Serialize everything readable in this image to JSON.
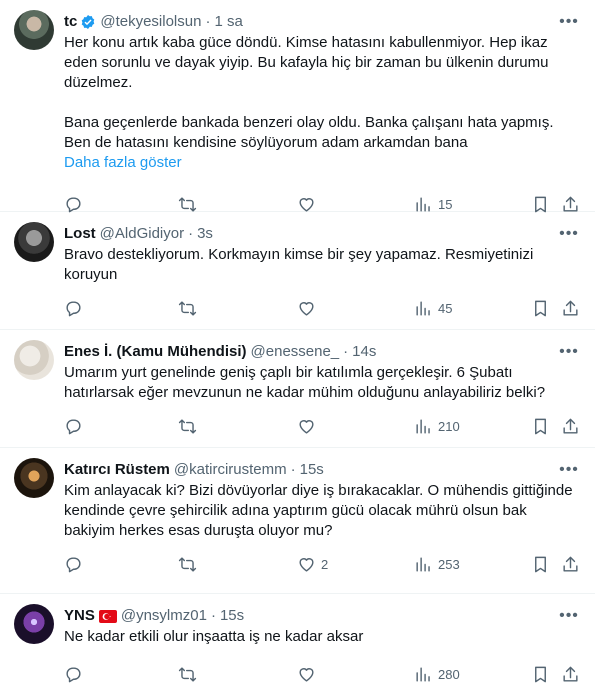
{
  "tweets": [
    {
      "name": "tc",
      "handle": "@tekyesilolsun",
      "dot": "·",
      "time": "1 sa",
      "text": "Her konu artık kaba güce döndü. Kimse hatasını kabullenmiyor. Hep ikaz eden sorunlu ve dayak yiyip. Bu kafayla hiç bir zaman bu ülkenin durumu düzelmez.\n\nBana geçenlerde bankada benzeri olay oldu. Banka çalışanı hata yapmış. Ben de hatasını kendisine söylüyorum adam arkamdan bana",
      "show_more": "Daha fazla göster",
      "views": "15",
      "verified": true
    },
    {
      "name": "Lost",
      "handle": "@AldGidiyor",
      "dot": "·",
      "time": "3s",
      "text": "Bravo destekliyorum. Korkmayın kimse bir şey yapamaz. Resmiyetinizi koruyun",
      "views": "45"
    },
    {
      "name": "Enes İ. (Kamu Mühendisi)",
      "handle": "@enessene_",
      "dot": "·",
      "time": "14s",
      "text": "Umarım yurt genelinde geniş çaplı bir katılımla gerçekleşir. 6 Şubatı hatırlarsak eğer mevzunun ne kadar mühim olduğunu anlayabiliriz belki?",
      "views": "210"
    },
    {
      "name": "Katırcı Rüstem",
      "handle": "@katircirustemm",
      "dot": "·",
      "time": "15s",
      "text": "Kim anlayacak ki? Bizi dövüyorlar diye iş bırakacaklar. O mühendis gittiğinde kendinde çevre şehircilik adına yaptırım gücü olacak mührü olsun bak bakiyim herkes esas duruşta oluyor mu?",
      "likes": "2",
      "views": "253"
    },
    {
      "name": "YNS",
      "handle": "@ynsylmz01",
      "dot": "·",
      "time": "15s",
      "text": "Ne kadar etkili olur inşaatta iş ne kadar aksar",
      "views": "280",
      "flag": "turkey-flag"
    }
  ],
  "icons": {
    "reply": "reply-icon",
    "retweet": "retweet-icon",
    "like": "heart-icon",
    "views": "views-icon",
    "bookmark": "bookmark-icon",
    "share": "share-icon",
    "more": "more-icon",
    "verified": "verified-badge-icon"
  },
  "colors": {
    "link": "#1d9bf0",
    "secondary": "#536471",
    "verified": "#1d9bf0",
    "flag": "#e30a17"
  }
}
